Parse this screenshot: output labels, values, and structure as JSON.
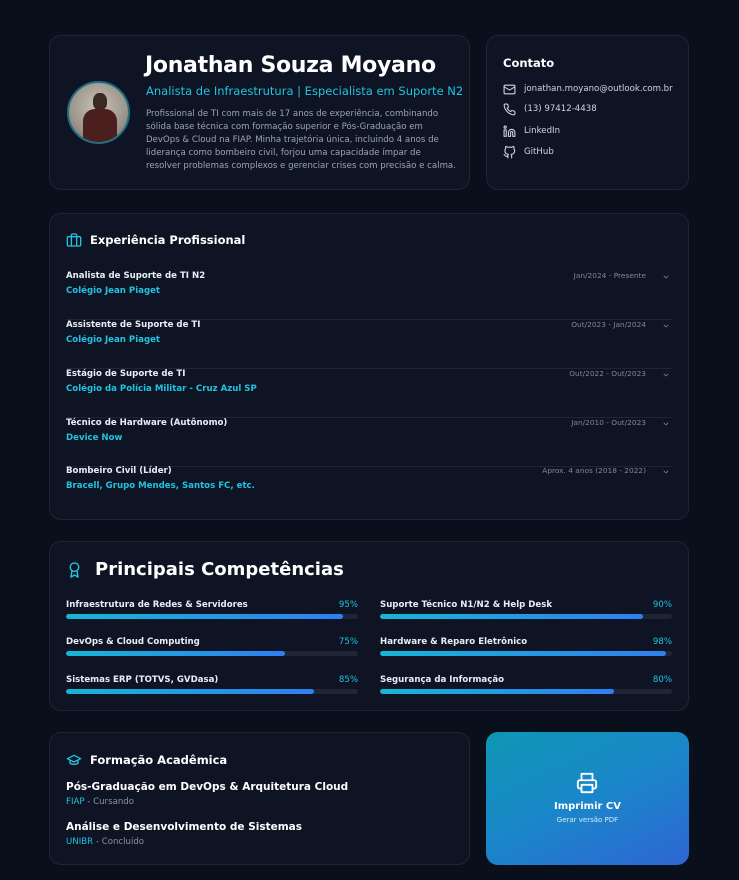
{
  "profile": {
    "name": "Jonathan Souza Moyano",
    "role": "Analista de Infraestrutura | Especialista em Suporte N2",
    "summary": "Profissional de TI com mais de 17 anos de experiência, combinando sólida base técnica com formação superior e Pós-Graduação em DevOps & Cloud na FIAP. Minha trajetória única, incluindo 4 anos de liderança como bombeiro civil, forjou uma capacidade ímpar de resolver problemas complexos e gerenciar crises com precisão e calma."
  },
  "contact": {
    "title": "Contato",
    "email": "jonathan.moyano@outlook.com.br",
    "phone": "(13) 97412-4438",
    "linkedin": "LinkedIn",
    "github": "GitHub"
  },
  "experience": {
    "title": "Experiência Profissional",
    "items": [
      {
        "role": "Analista de Suporte de TI N2",
        "company": "Colégio Jean Piaget",
        "date": "Jan/2024 - Presente"
      },
      {
        "role": "Assistente de Suporte de TI",
        "company": "Colégio Jean Piaget",
        "date": "Out/2023 - Jan/2024"
      },
      {
        "role": "Estágio de Suporte de TI",
        "company": "Colégio da Polícia Militar - Cruz Azul SP",
        "date": "Out/2022 - Out/2023"
      },
      {
        "role": "Técnico de Hardware (Autônomo)",
        "company": "Device Now",
        "date": "Jan/2010 - Out/2023"
      },
      {
        "role": "Bombeiro Civil (Líder)",
        "company": "Bracell, Grupo Mendes, Santos FC, etc.",
        "date": "Aprox. 4 anos (2018 - 2022)"
      }
    ]
  },
  "skills": {
    "title": "Principais Competências",
    "items": [
      {
        "label": "Infraestrutura de Redes & Servidores",
        "percent": 95,
        "percent_text": "95%"
      },
      {
        "label": "Suporte Técnico N1/N2 & Help Desk",
        "percent": 90,
        "percent_text": "90%"
      },
      {
        "label": "DevOps & Cloud Computing",
        "percent": 75,
        "percent_text": "75%"
      },
      {
        "label": "Hardware & Reparo Eletrônico",
        "percent": 98,
        "percent_text": "98%"
      },
      {
        "label": "Sistemas ERP (TOTVS, GVDasa)",
        "percent": 85,
        "percent_text": "85%"
      },
      {
        "label": "Segurança da Informação",
        "percent": 80,
        "percent_text": "80%"
      }
    ]
  },
  "education": {
    "title": "Formação Acadêmica",
    "items": [
      {
        "course": "Pós-Graduação em DevOps & Arquitetura Cloud",
        "institution": "FIAP",
        "status": " - Cursando"
      },
      {
        "course": "Análise e Desenvolvimento de Sistemas",
        "institution": "UNIBR",
        "status": " - Concluído"
      }
    ]
  },
  "print": {
    "title": "Imprimir CV",
    "subtitle": "Gerar versão PDF"
  },
  "colors": {
    "background": "#0a0f1c",
    "card": "#0e1424",
    "accent": "#22c3e0",
    "bar_start": "#16b6d6",
    "bar_end": "#2f7ff0"
  },
  "icons": {
    "contact": [
      "mail-icon",
      "phone-icon",
      "linkedin-icon",
      "github-icon"
    ],
    "experience": "briefcase-icon",
    "skills": "award-icon",
    "education": "graduation-cap-icon",
    "print": "printer-icon",
    "expand": "chevron-down-icon"
  }
}
